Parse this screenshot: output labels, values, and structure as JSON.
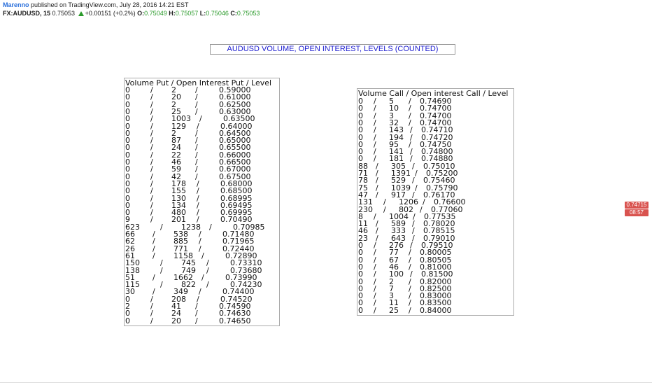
{
  "header": {
    "author": "Marenno",
    "published": " published on TradingView.com, July 28, 2016 14:21 EST",
    "symbol": "FX:AUDUSD, 15",
    "last": "0.75053",
    "change": "+0.00151 (+0.2%)",
    "o_label": "O:",
    "o": "0.75049",
    "h_label": "H:",
    "h": "0.75057",
    "l_label": "L:",
    "l": "0.75046",
    "c_label": "C:",
    "c": "0.75053"
  },
  "title": "AUDUSD VOLUME, OPEN INTEREST, LEVELS (COUNTED)",
  "put_panel": {
    "header": "Volume Put / Open Interest Put / Level",
    "rows": [
      [
        "0",
        "2",
        "0.59000"
      ],
      [
        "0",
        "20",
        "0.61000"
      ],
      [
        "0",
        "2",
        "0.62500"
      ],
      [
        "0",
        "25",
        "0.63000"
      ],
      [
        "0",
        "1003",
        "0.63500"
      ],
      [
        "0",
        "129",
        "0.64000"
      ],
      [
        "0",
        "2",
        "0.64500"
      ],
      [
        "0",
        "87",
        "0.65000"
      ],
      [
        "0",
        "24",
        "0.65500"
      ],
      [
        "0",
        "22",
        "0.66000"
      ],
      [
        "0",
        "46",
        "0.66500"
      ],
      [
        "0",
        "59",
        "0.67000"
      ],
      [
        "0",
        "42",
        "0.67500"
      ],
      [
        "0",
        "178",
        "0.68000"
      ],
      [
        "0",
        "155",
        "0.68500"
      ],
      [
        "0",
        "130",
        "0.68995"
      ],
      [
        "0",
        "134",
        "0.69495"
      ],
      [
        "0",
        "480",
        "0.69995"
      ],
      [
        "9",
        "201",
        "0.70490"
      ],
      [
        "623",
        "1238",
        "0.70985"
      ],
      [
        "66",
        "538",
        "0.71480"
      ],
      [
        "62",
        "885",
        "0.71965"
      ],
      [
        "26",
        "771",
        "0.72440"
      ],
      [
        "61",
        "1158",
        "0.72890"
      ],
      [
        "150",
        "745",
        "0.73310"
      ],
      [
        "138",
        "749",
        "0.73680"
      ],
      [
        "51",
        "1662",
        "0.73990"
      ],
      [
        "115",
        "822",
        "0.74230"
      ],
      [
        "30",
        "349",
        "0.74400"
      ],
      [
        "0",
        "208",
        "0.74520"
      ],
      [
        "2",
        "41",
        "0.74590"
      ],
      [
        "0",
        "24",
        "0.74630"
      ],
      [
        "0",
        "20",
        "0.74650"
      ]
    ]
  },
  "call_panel": {
    "header": "Volume Call / Open interest Call / Level",
    "rows": [
      [
        "0",
        "5",
        "0.74690"
      ],
      [
        "0",
        "10",
        "0.74700"
      ],
      [
        "0",
        "3",
        "0.74700"
      ],
      [
        "0",
        "32",
        "0.74700"
      ],
      [
        "0",
        "143",
        "0.74710"
      ],
      [
        "0",
        "194",
        "0.74720"
      ],
      [
        "0",
        "95",
        "0.74750"
      ],
      [
        "0",
        "141",
        "0.74800"
      ],
      [
        "0",
        "181",
        "0.74880"
      ],
      [
        "88",
        "305",
        "0.75010"
      ],
      [
        "71",
        "1391",
        "0.75200"
      ],
      [
        "78",
        "529",
        "0.75460"
      ],
      [
        "75",
        "1039",
        "0.75790"
      ],
      [
        "47",
        "917",
        "0.76170"
      ],
      [
        "131",
        "1206",
        "0.76600"
      ],
      [
        "230",
        "802",
        "0.77060"
      ],
      [
        "8",
        "1004",
        "0.77535"
      ],
      [
        "11",
        "589",
        "0.78020"
      ],
      [
        "46",
        "333",
        "0.78515"
      ],
      [
        "23",
        "643",
        "0.79010"
      ],
      [
        "0",
        "276",
        "0.79510"
      ],
      [
        "0",
        "77",
        "0.80005"
      ],
      [
        "0",
        "67",
        "0.80505"
      ],
      [
        "0",
        "46",
        "0.81000"
      ],
      [
        "0",
        "100",
        "0.81500"
      ],
      [
        "0",
        "2",
        "0.82000"
      ],
      [
        "0",
        "7",
        "0.82500"
      ],
      [
        "0",
        "3",
        "0.83000"
      ],
      [
        "0",
        "11",
        "0.83500"
      ],
      [
        "0",
        "25",
        "0.84000"
      ]
    ]
  },
  "price_tags": {
    "price": "0.74715",
    "time": "08:57",
    "color": "#d9534f"
  }
}
